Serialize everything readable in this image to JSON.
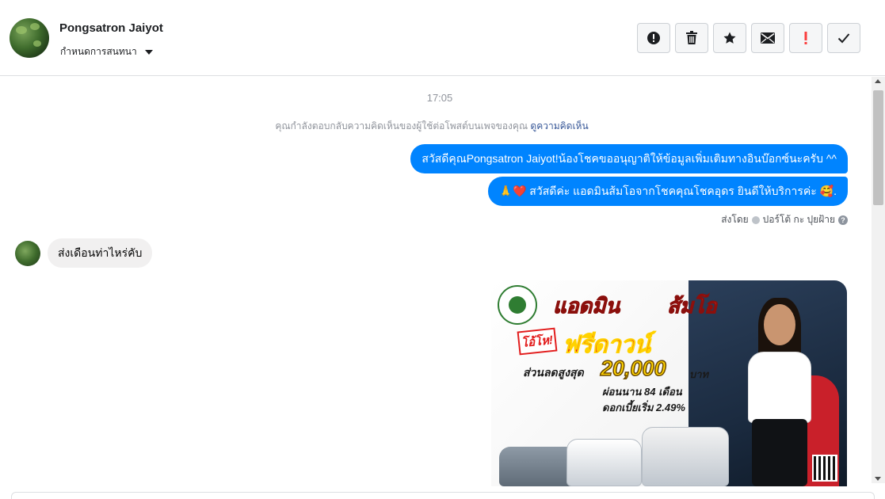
{
  "header": {
    "name": "Pongsatron Jaiyot",
    "subtitle": "กำหนดการสนทนา",
    "actions": [
      {
        "icon": "alert-circle-icon",
        "name": "report-button"
      },
      {
        "icon": "trash-icon",
        "name": "delete-button"
      },
      {
        "icon": "star-icon",
        "name": "star-button"
      },
      {
        "icon": "envelope-icon",
        "name": "mark-unread-button"
      },
      {
        "icon": "exclamation-icon",
        "name": "mark-spam-button"
      },
      {
        "icon": "check-icon",
        "name": "mark-done-button"
      }
    ]
  },
  "conversation": {
    "time": "17:05",
    "context_text": "คุณกำลังตอบกลับความคิดเห็นของผู้ใช้ต่อโพสต์บนเพจของคุณ",
    "context_link": "ดูความคิดเห็น",
    "outgoing": [
      "สวัสดีคุณPongsatron Jaiyot!น้องโชคขออนุญาติให้ข้อมูลเพิ่มเติมทางอินบ๊อกซ์นะครับ ^^",
      "🙏❤️ สวัสดีค่ะ แอดมินส้มโอจากโชคคุณโชคอุดร ยินดีให้บริการค่ะ 🥰."
    ],
    "sent_by_label": "ส่งโดย",
    "sent_by_name": "ปอร์โต้ กะ ปุยฝ้าย",
    "incoming": "ส่งเดือนท่าไหร่คับ"
  },
  "ad": {
    "title_left": "แอดมิน",
    "title_right": "ส้มโอ",
    "badge": "โอ้โห!",
    "headline": "ฟรีดาวน์",
    "discount_label": "ส่วนลดสูงสุด",
    "discount_amount": "20,000",
    "discount_unit": "บาท",
    "installment": "ผ่อนนาน 84 เดือน",
    "interest": "ดอกเบี้ยเริ่ม 2.49%"
  },
  "colors": {
    "outgoing_bubble": "#0084ff",
    "incoming_bubble": "#f1f0f0",
    "link": "#385898",
    "spam_accent": "#fa3e3e"
  }
}
